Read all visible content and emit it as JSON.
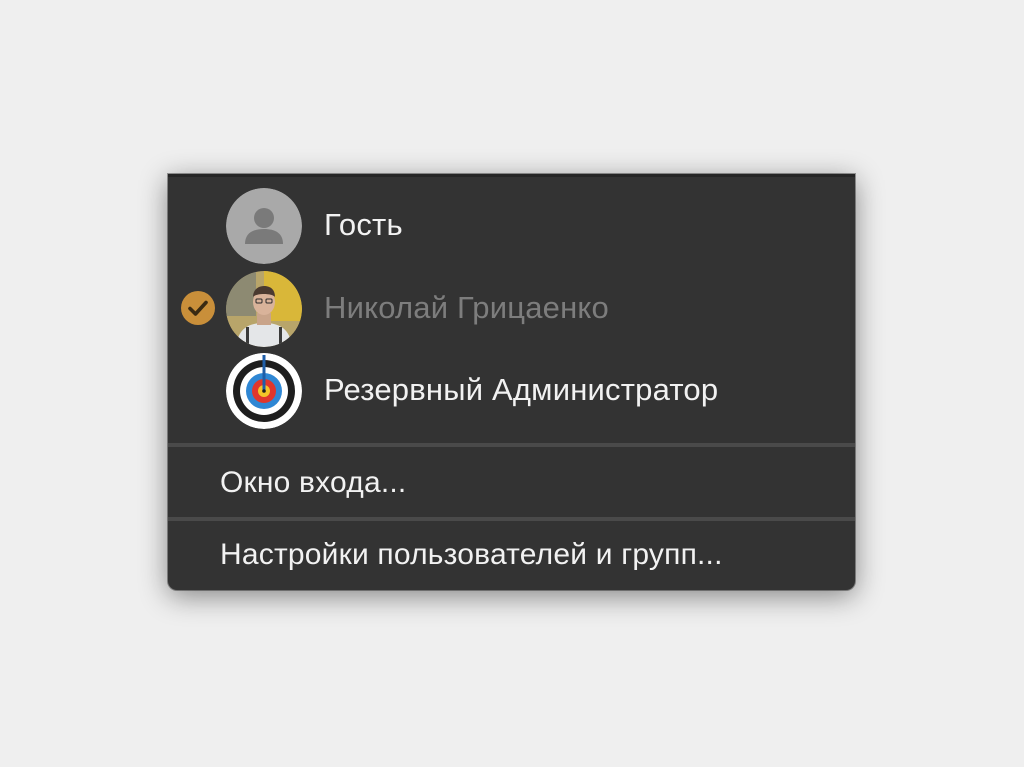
{
  "users": [
    {
      "name": "Гость",
      "avatar_icon": "guest-person-icon",
      "current": false
    },
    {
      "name": "Николай Грицаенко",
      "avatar_icon": "user-photo-icon",
      "current": true
    },
    {
      "name": "Резервный Администратор",
      "avatar_icon": "target-icon",
      "current": false
    }
  ],
  "current_check_icon": "checkmark-icon",
  "menu_items": [
    {
      "label": "Окно входа..."
    },
    {
      "label": "Настройки пользователей и групп..."
    }
  ],
  "colors": {
    "menu_background": "#333333",
    "check_accent": "#c98f3a",
    "current_user_text": "#7d7d7d",
    "page_background": "#efefef"
  }
}
